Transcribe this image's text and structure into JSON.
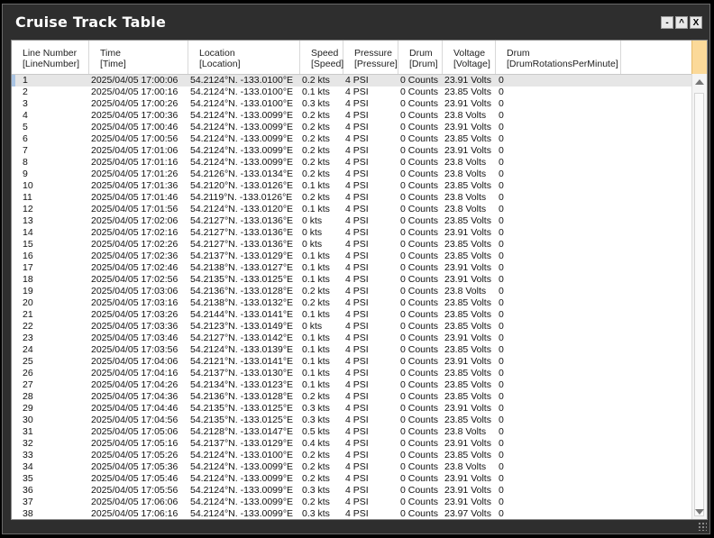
{
  "window": {
    "title": "Cruise Track Table",
    "controls": {
      "minimize": "-",
      "maximize": "^",
      "close": "X"
    }
  },
  "columns": [
    {
      "name": "Line Number",
      "field": "[LineNumber]"
    },
    {
      "name": "Time",
      "field": "[Time]"
    },
    {
      "name": "Location",
      "field": "[Location]"
    },
    {
      "name": "Speed",
      "field": "[Speed]"
    },
    {
      "name": "Pressure",
      "field": "[Pressure]"
    },
    {
      "name": "Drum",
      "field": "[Drum]"
    },
    {
      "name": "Voltage",
      "field": "[Voltage]"
    },
    {
      "name": "Drum",
      "field": "[DrumRotationsPerMinute]"
    }
  ],
  "rows": [
    [
      "1",
      "2025/04/05 17:00:06",
      "54.2124°N. -133.0100°E",
      "0.2 kts",
      "4 PSI",
      "0 Counts",
      "23.91 Volts",
      "0"
    ],
    [
      "2",
      "2025/04/05 17:00:16",
      "54.2124°N. -133.0100°E",
      "0.1 kts",
      "4 PSI",
      "0 Counts",
      "23.85 Volts",
      "0"
    ],
    [
      "3",
      "2025/04/05 17:00:26",
      "54.2124°N. -133.0100°E",
      "0.3 kts",
      "4 PSI",
      "0 Counts",
      "23.91 Volts",
      "0"
    ],
    [
      "4",
      "2025/04/05 17:00:36",
      "54.2124°N. -133.0099°E",
      "0.2 kts",
      "4 PSI",
      "0 Counts",
      "23.8 Volts",
      "0"
    ],
    [
      "5",
      "2025/04/05 17:00:46",
      "54.2124°N. -133.0099°E",
      "0.2 kts",
      "4 PSI",
      "0 Counts",
      "23.91 Volts",
      "0"
    ],
    [
      "6",
      "2025/04/05 17:00:56",
      "54.2124°N. -133.0099°E",
      "0.2 kts",
      "4 PSI",
      "0 Counts",
      "23.85 Volts",
      "0"
    ],
    [
      "7",
      "2025/04/05 17:01:06",
      "54.2124°N. -133.0099°E",
      "0.2 kts",
      "4 PSI",
      "0 Counts",
      "23.91 Volts",
      "0"
    ],
    [
      "8",
      "2025/04/05 17:01:16",
      "54.2124°N. -133.0099°E",
      "0.2 kts",
      "4 PSI",
      "0 Counts",
      "23.8 Volts",
      "0"
    ],
    [
      "9",
      "2025/04/05 17:01:26",
      "54.2126°N. -133.0134°E",
      "0.2 kts",
      "4 PSI",
      "0 Counts",
      "23.8 Volts",
      "0"
    ],
    [
      "10",
      "2025/04/05 17:01:36",
      "54.2120°N. -133.0126°E",
      "0.1 kts",
      "4 PSI",
      "0 Counts",
      "23.85 Volts",
      "0"
    ],
    [
      "11",
      "2025/04/05 17:01:46",
      "54.2119°N. -133.0126°E",
      "0.2 kts",
      "4 PSI",
      "0 Counts",
      "23.8 Volts",
      "0"
    ],
    [
      "12",
      "2025/04/05 17:01:56",
      "54.2124°N. -133.0120°E",
      "0.1 kts",
      "4 PSI",
      "0 Counts",
      "23.8 Volts",
      "0"
    ],
    [
      "13",
      "2025/04/05 17:02:06",
      "54.2127°N. -133.0136°E",
      "0 kts",
      "4 PSI",
      "0 Counts",
      "23.85 Volts",
      "0"
    ],
    [
      "14",
      "2025/04/05 17:02:16",
      "54.2127°N. -133.0136°E",
      "0 kts",
      "4 PSI",
      "0 Counts",
      "23.91 Volts",
      "0"
    ],
    [
      "15",
      "2025/04/05 17:02:26",
      "54.2127°N. -133.0136°E",
      "0 kts",
      "4 PSI",
      "0 Counts",
      "23.85 Volts",
      "0"
    ],
    [
      "16",
      "2025/04/05 17:02:36",
      "54.2137°N. -133.0129°E",
      "0.1 kts",
      "4 PSI",
      "0 Counts",
      "23.85 Volts",
      "0"
    ],
    [
      "17",
      "2025/04/05 17:02:46",
      "54.2138°N. -133.0127°E",
      "0.1 kts",
      "4 PSI",
      "0 Counts",
      "23.91 Volts",
      "0"
    ],
    [
      "18",
      "2025/04/05 17:02:56",
      "54.2135°N. -133.0125°E",
      "0.1 kts",
      "4 PSI",
      "0 Counts",
      "23.91 Volts",
      "0"
    ],
    [
      "19",
      "2025/04/05 17:03:06",
      "54.2136°N. -133.0128°E",
      "0.2 kts",
      "4 PSI",
      "0 Counts",
      "23.8 Volts",
      "0"
    ],
    [
      "20",
      "2025/04/05 17:03:16",
      "54.2138°N. -133.0132°E",
      "0.2 kts",
      "4 PSI",
      "0 Counts",
      "23.85 Volts",
      "0"
    ],
    [
      "21",
      "2025/04/05 17:03:26",
      "54.2144°N. -133.0141°E",
      "0.1 kts",
      "4 PSI",
      "0 Counts",
      "23.85 Volts",
      "0"
    ],
    [
      "22",
      "2025/04/05 17:03:36",
      "54.2123°N. -133.0149°E",
      "0 kts",
      "4 PSI",
      "0 Counts",
      "23.85 Volts",
      "0"
    ],
    [
      "23",
      "2025/04/05 17:03:46",
      "54.2127°N. -133.0142°E",
      "0.1 kts",
      "4 PSI",
      "0 Counts",
      "23.91 Volts",
      "0"
    ],
    [
      "24",
      "2025/04/05 17:03:56",
      "54.2124°N. -133.0139°E",
      "0.1 kts",
      "4 PSI",
      "0 Counts",
      "23.85 Volts",
      "0"
    ],
    [
      "25",
      "2025/04/05 17:04:06",
      "54.2121°N. -133.0141°E",
      "0.1 kts",
      "4 PSI",
      "0 Counts",
      "23.91 Volts",
      "0"
    ],
    [
      "26",
      "2025/04/05 17:04:16",
      "54.2137°N. -133.0130°E",
      "0.1 kts",
      "4 PSI",
      "0 Counts",
      "23.85 Volts",
      "0"
    ],
    [
      "27",
      "2025/04/05 17:04:26",
      "54.2134°N. -133.0123°E",
      "0.1 kts",
      "4 PSI",
      "0 Counts",
      "23.85 Volts",
      "0"
    ],
    [
      "28",
      "2025/04/05 17:04:36",
      "54.2136°N. -133.0128°E",
      "0.2 kts",
      "4 PSI",
      "0 Counts",
      "23.85 Volts",
      "0"
    ],
    [
      "29",
      "2025/04/05 17:04:46",
      "54.2135°N. -133.0125°E",
      "0.3 kts",
      "4 PSI",
      "0 Counts",
      "23.91 Volts",
      "0"
    ],
    [
      "30",
      "2025/04/05 17:04:56",
      "54.2135°N. -133.0125°E",
      "0.3 kts",
      "4 PSI",
      "0 Counts",
      "23.85 Volts",
      "0"
    ],
    [
      "31",
      "2025/04/05 17:05:06",
      "54.2128°N. -133.0147°E",
      "0.5 kts",
      "4 PSI",
      "0 Counts",
      "23.8 Volts",
      "0"
    ],
    [
      "32",
      "2025/04/05 17:05:16",
      "54.2137°N. -133.0129°E",
      "0.4 kts",
      "4 PSI",
      "0 Counts",
      "23.91 Volts",
      "0"
    ],
    [
      "33",
      "2025/04/05 17:05:26",
      "54.2124°N. -133.0100°E",
      "0.2 kts",
      "4 PSI",
      "0 Counts",
      "23.85 Volts",
      "0"
    ],
    [
      "34",
      "2025/04/05 17:05:36",
      "54.2124°N. -133.0099°E",
      "0.2 kts",
      "4 PSI",
      "0 Counts",
      "23.8 Volts",
      "0"
    ],
    [
      "35",
      "2025/04/05 17:05:46",
      "54.2124°N. -133.0099°E",
      "0.2 kts",
      "4 PSI",
      "0 Counts",
      "23.91 Volts",
      "0"
    ],
    [
      "36",
      "2025/04/05 17:05:56",
      "54.2124°N. -133.0099°E",
      "0.3 kts",
      "4 PSI",
      "0 Counts",
      "23.91 Volts",
      "0"
    ],
    [
      "37",
      "2025/04/05 17:06:06",
      "54.2124°N. -133.0099°E",
      "0.2 kts",
      "4 PSI",
      "0 Counts",
      "23.91 Volts",
      "0"
    ],
    [
      "38",
      "2025/04/05 17:06:16",
      "54.2124°N. -133.0099°E",
      "0.3 kts",
      "4 PSI",
      "0 Counts",
      "23.97 Volts",
      "0"
    ]
  ],
  "selected_row": 0,
  "colors": {
    "titlebar": "#2e2e2e",
    "header_corner": "#fbd999",
    "selected_row": "#e6e6e6"
  }
}
